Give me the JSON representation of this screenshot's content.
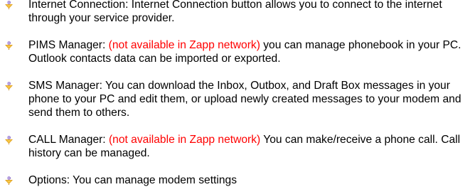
{
  "items": [
    {
      "icon": "arrow-down-bullet-icon",
      "line1": "Internet Connection: Internet Connection button allows you to connect to the internet",
      "line2": "through your service provider."
    },
    {
      "icon": "arrow-down-bullet-icon",
      "prefix": "PIMS Manager: ",
      "note": "(not available in Zapp network)",
      "rest": " you can manage phonebook in your PC.",
      "line2": "Outlook contacts data can be imported or exported."
    },
    {
      "icon": "arrow-down-bullet-icon",
      "line1": "SMS Manager: You can download the Inbox, Outbox, and Draft Box messages in your",
      "line2": "phone to your PC and edit them, or upload newly created messages to your modem and",
      "line3": "send them to others."
    },
    {
      "icon": "arrow-down-bullet-icon",
      "prefix": "CALL Manager: ",
      "note": "(not available in Zapp network)",
      "rest": " You can make/receive a phone call. Call",
      "line2": "history can be managed."
    },
    {
      "icon": "arrow-down-bullet-icon",
      "line1": "Options: You can manage modem settings"
    }
  ],
  "colors": {
    "note": "#ff0000",
    "bullet_top": "#b8a3e0",
    "bullet_bottom": "#e0a020"
  }
}
